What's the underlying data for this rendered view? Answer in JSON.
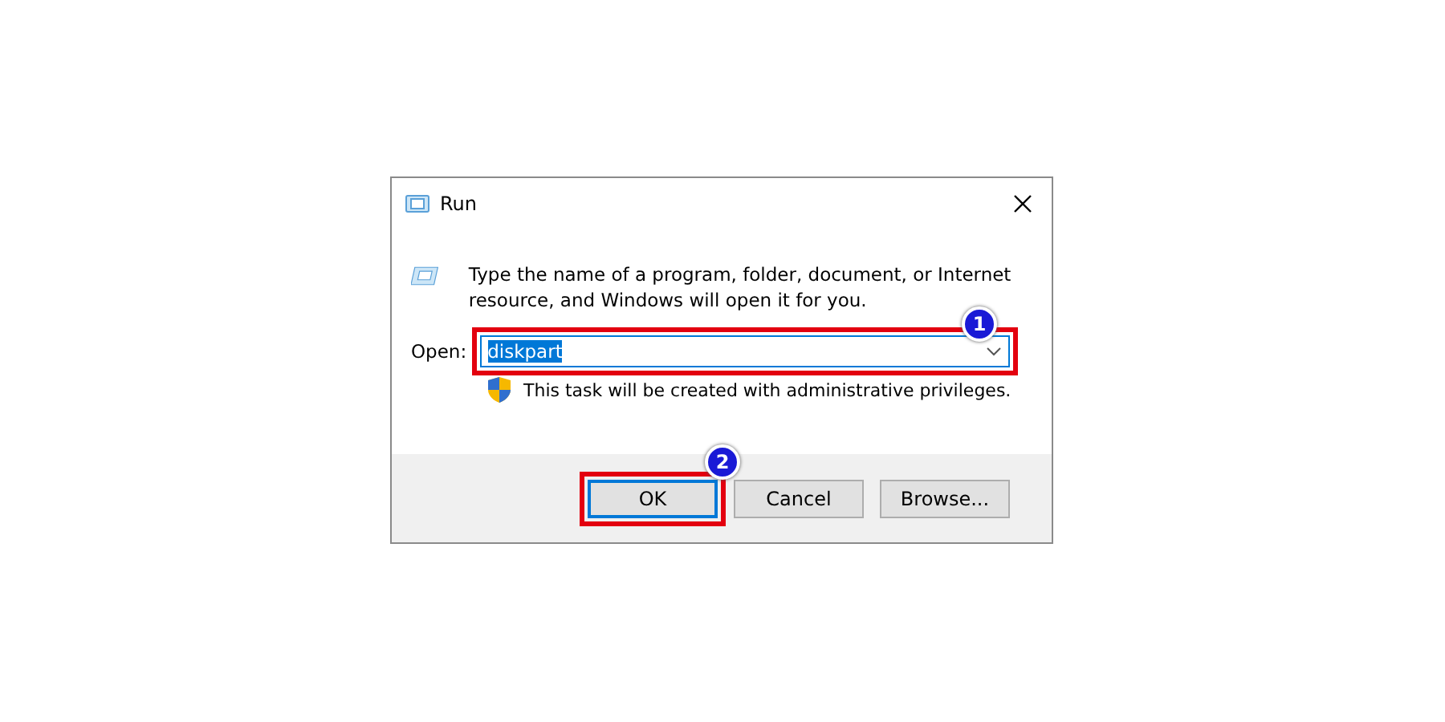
{
  "window": {
    "title": "Run"
  },
  "description": "Type the name of a program, folder, document, or Internet resource, and Windows will open it for you.",
  "open_field": {
    "label": "Open:",
    "value": "diskpart",
    "highlighted": true,
    "callout": "1"
  },
  "admin_note": "This task will be created with administrative privileges.",
  "buttons": [
    {
      "label": "OK",
      "default": true,
      "highlighted": true,
      "callout": "2"
    },
    {
      "label": "Cancel",
      "default": false,
      "highlighted": false
    },
    {
      "label": "Browse...",
      "default": false,
      "highlighted": false
    }
  ]
}
